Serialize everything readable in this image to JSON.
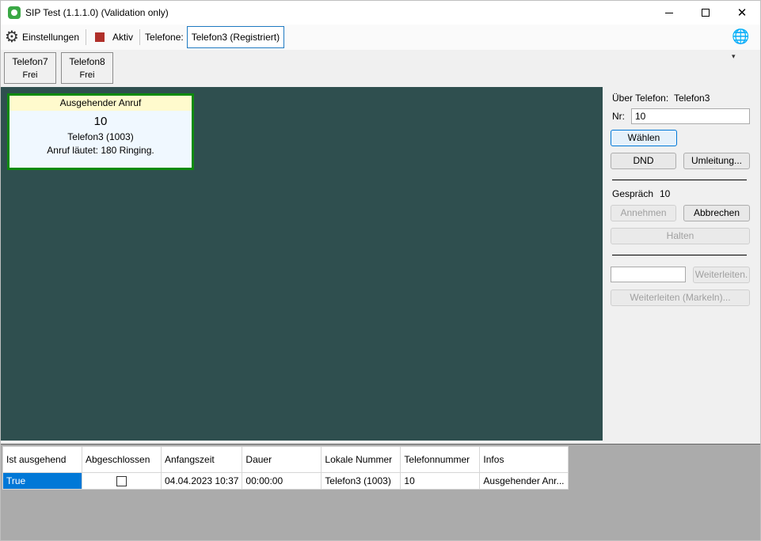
{
  "window": {
    "title": "SIP Test (1.1.1.0) (Validation only)"
  },
  "toolbar": {
    "settings_label": "Einstellungen",
    "active_label": "Aktiv",
    "phones_label": "Telefone:",
    "phones_selected": "Telefon3 (Registriert)"
  },
  "phones": [
    {
      "name": "Telefon7",
      "status": "Frei"
    },
    {
      "name": "Telefon8",
      "status": "Frei"
    }
  ],
  "call_card": {
    "header": "Ausgehender Anruf",
    "number": "10",
    "local": "Telefon3 (1003)",
    "status": "Anruf läutet: 180 Ringing."
  },
  "panel": {
    "via_label": "Über Telefon:",
    "via_value": "Telefon3",
    "nr_label": "Nr:",
    "nr_value": "10",
    "dial_button": "Wählen",
    "dnd_button": "DND",
    "redirect_button": "Umleitung...",
    "conversation_label": "Gespräch",
    "conversation_value": "10",
    "accept_button": "Annehmen",
    "cancel_button": "Abbrechen",
    "hold_button": "Halten",
    "forward_input": "",
    "forward_button": "Weiterleiten.",
    "forward_mark_button": "Weiterleiten (Markeln)..."
  },
  "grid": {
    "headers": [
      "Ist ausgehend",
      "Abgeschlossen",
      "Anfangszeit",
      "Dauer",
      "Lokale Nummer",
      "Telefonnummer",
      "Infos"
    ],
    "rows": [
      {
        "outgoing": "True",
        "completed": false,
        "start": "04.04.2023 10:37",
        "duration": "00:00:00",
        "local": "Telefon3 (1003)",
        "number": "10",
        "info": "Ausgehender Anr..."
      }
    ]
  }
}
